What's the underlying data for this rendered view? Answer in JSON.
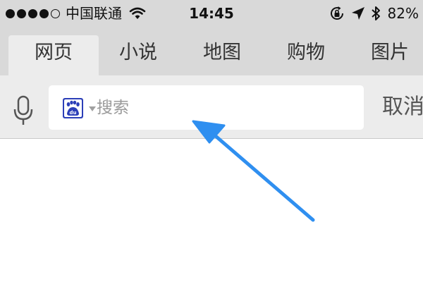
{
  "status_bar": {
    "carrier": "中国联通",
    "time": "14:45",
    "battery": "82%",
    "signal_bars_filled": 4,
    "signal_bars_total": 5,
    "icons": [
      "signal-dots-icon",
      "wifi-icon",
      "rotation-lock-icon",
      "location-arrow-icon",
      "bluetooth-icon"
    ]
  },
  "tabs": [
    {
      "label": "网页",
      "active": true
    },
    {
      "label": "小说",
      "active": false
    },
    {
      "label": "地图",
      "active": false
    },
    {
      "label": "购物",
      "active": false
    },
    {
      "label": "图片",
      "active": false
    }
  ],
  "search": {
    "placeholder": "搜索",
    "value": "",
    "engine_logo_text": "du",
    "engine_logo_icon": "baidu-paw-icon",
    "mic_icon": "microphone-icon",
    "cancel_label": "取消"
  },
  "annotation": {
    "icon": "arrow-annotation-icon",
    "color": "#2f8ff0"
  },
  "colors": {
    "bar_background": "#d9d9d9",
    "search_row_background": "#ececec",
    "baidu_blue": "#2c3fb8"
  }
}
